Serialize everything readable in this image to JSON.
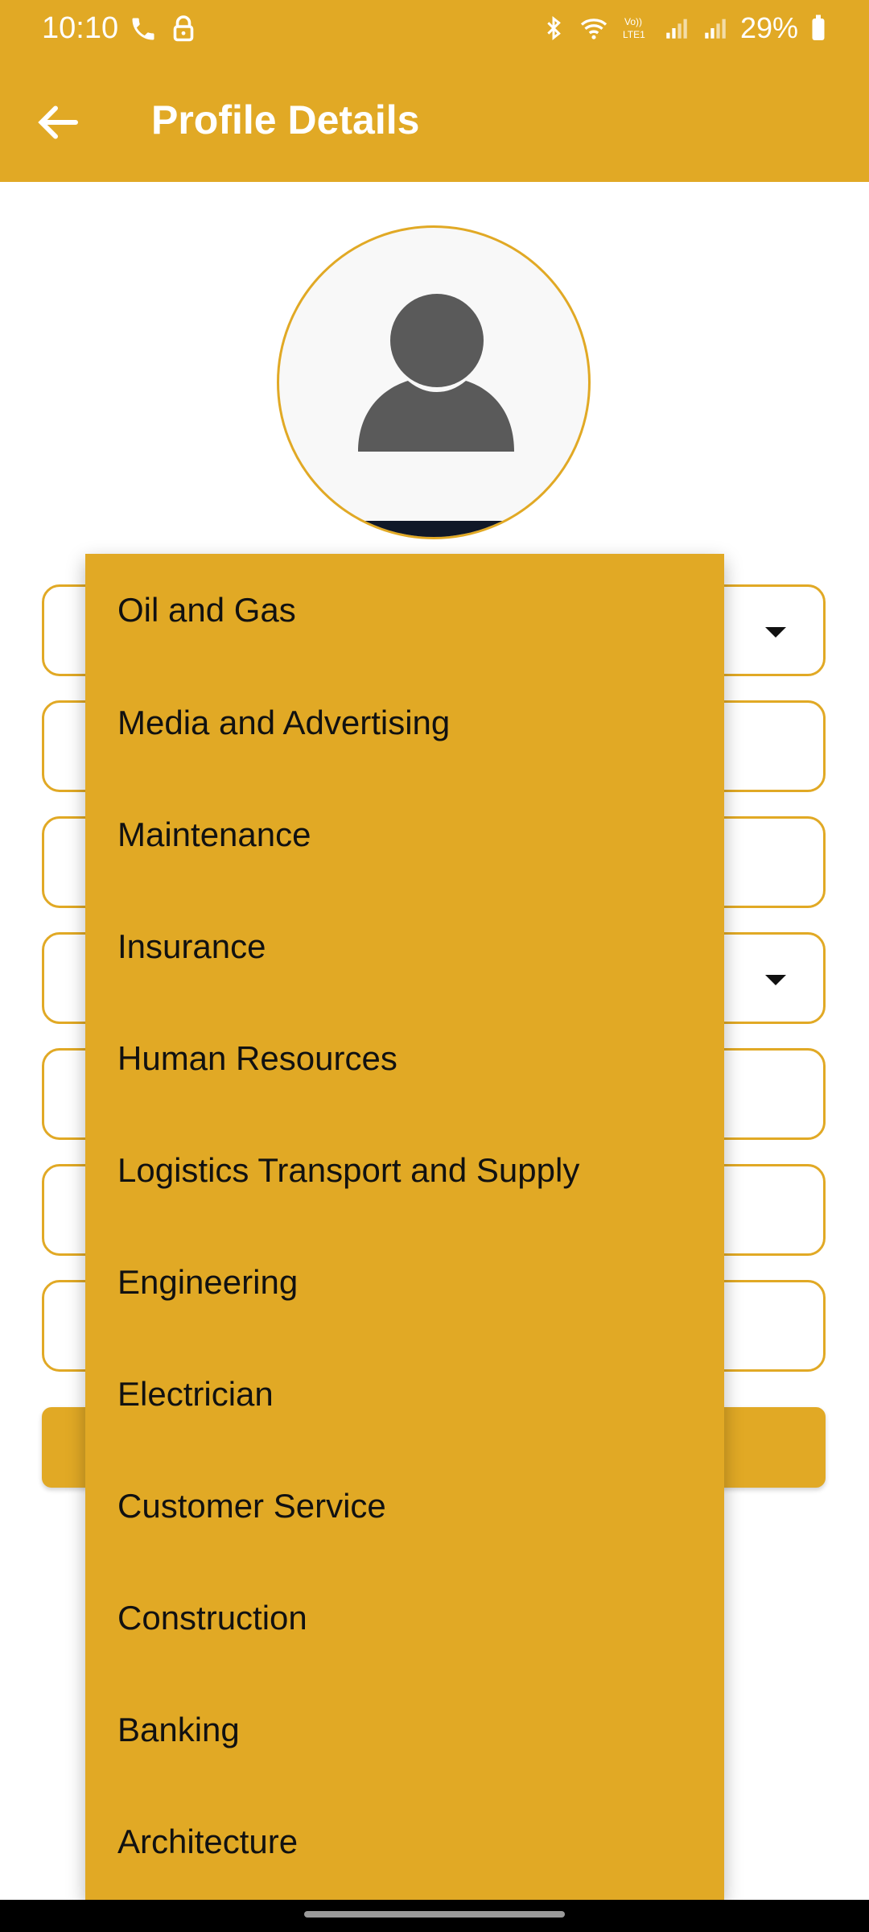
{
  "status_bar": {
    "time": "10:10",
    "battery": "29%",
    "network_badge": "Vo))\nLTE1"
  },
  "app_bar": {
    "title": "Profile Details",
    "back_icon": "arrow-left-icon"
  },
  "colors": {
    "accent": "#E1A925",
    "avatar_icon": "#5a5a5a"
  },
  "dropdown_menu": {
    "items": [
      "Oil and Gas",
      "Media and Advertising",
      "Maintenance",
      "Insurance",
      "Human Resources",
      "Logistics Transport and Supply",
      "Engineering",
      "Electrician",
      "Customer Service",
      "Construction",
      "Banking",
      "Architecture"
    ]
  }
}
